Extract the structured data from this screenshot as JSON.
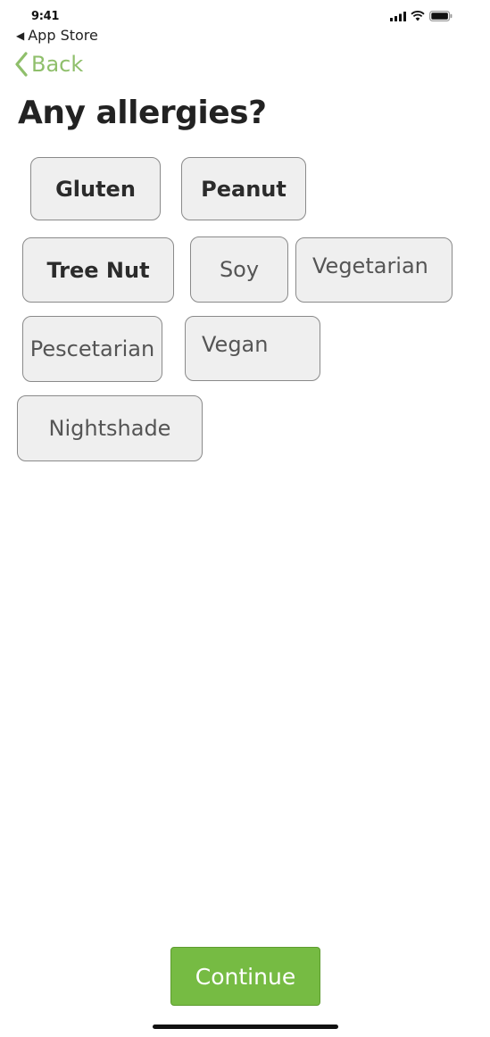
{
  "status_bar": {
    "time": "9:41"
  },
  "app_return": {
    "label": "App Store"
  },
  "nav": {
    "back_label": "Back",
    "accent_color": "#8fbf6b"
  },
  "page": {
    "title": "Any allergies?"
  },
  "options": [
    {
      "label": "Gluten",
      "selected": true
    },
    {
      "label": "Peanut",
      "selected": true
    },
    {
      "label": "Tree Nut",
      "selected": true
    },
    {
      "label": "Soy",
      "selected": false
    },
    {
      "label": "Vegetarian",
      "selected": false
    },
    {
      "label": "Pescetarian",
      "selected": false
    },
    {
      "label": "Vegan",
      "selected": false
    },
    {
      "label": "Nightshade",
      "selected": false
    }
  ],
  "footer": {
    "continue_label": "Continue",
    "continue_color": "#76bb43"
  }
}
